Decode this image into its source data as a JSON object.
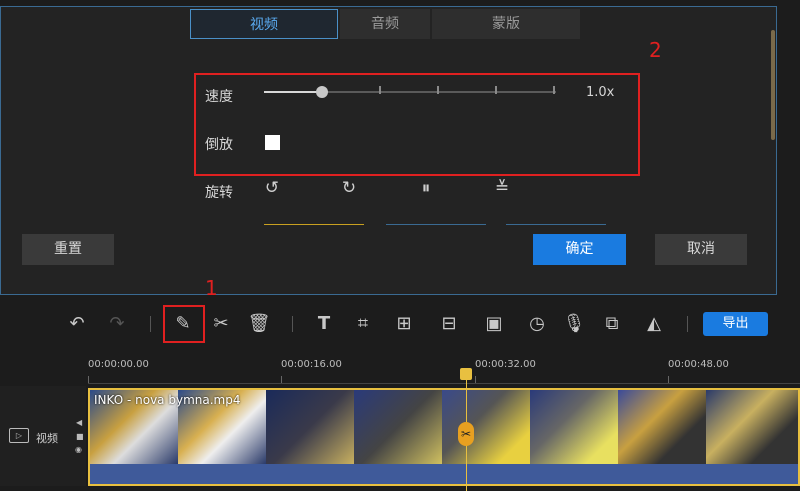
{
  "tabs": [
    {
      "label": "视频",
      "active": true
    },
    {
      "label": "音频",
      "active": false
    },
    {
      "label": "蒙版",
      "active": false
    }
  ],
  "speed": {
    "label": "速度",
    "value_text": "1.0x",
    "fraction": 0.2
  },
  "reverse": {
    "label": "倒放",
    "checked": true
  },
  "rotate": {
    "label": "旋转"
  },
  "buttons": {
    "reset": "重置",
    "confirm": "确定",
    "cancel": "取消",
    "export": "导出"
  },
  "annotations": {
    "one": "1",
    "two": "2"
  },
  "ruler": [
    "00:00:00.00",
    "00:00:16.00",
    "00:00:32.00",
    "00:00:48.00"
  ],
  "track": {
    "label": "视频",
    "clip_name": "INKO - nova bymna.mp4"
  },
  "colors": {
    "accent": "#1a7be0",
    "annotation": "#e02020",
    "playhead": "#e8c040",
    "clip_bottom": "#3f5a9a"
  },
  "icons": {
    "toolbar": [
      "undo-icon",
      "redo-icon",
      "pencil-icon",
      "scissors-icon",
      "trash-icon",
      "text-icon",
      "crop-icon",
      "mosaic-icon",
      "split-screen-icon",
      "freeze-frame-icon",
      "duration-icon",
      "microphone-icon",
      "picture-in-picture-icon",
      "color-fill-icon"
    ],
    "rotate": [
      "rotate-left-icon",
      "rotate-right-icon",
      "flip-horizontal-icon",
      "flip-vertical-icon"
    ]
  }
}
